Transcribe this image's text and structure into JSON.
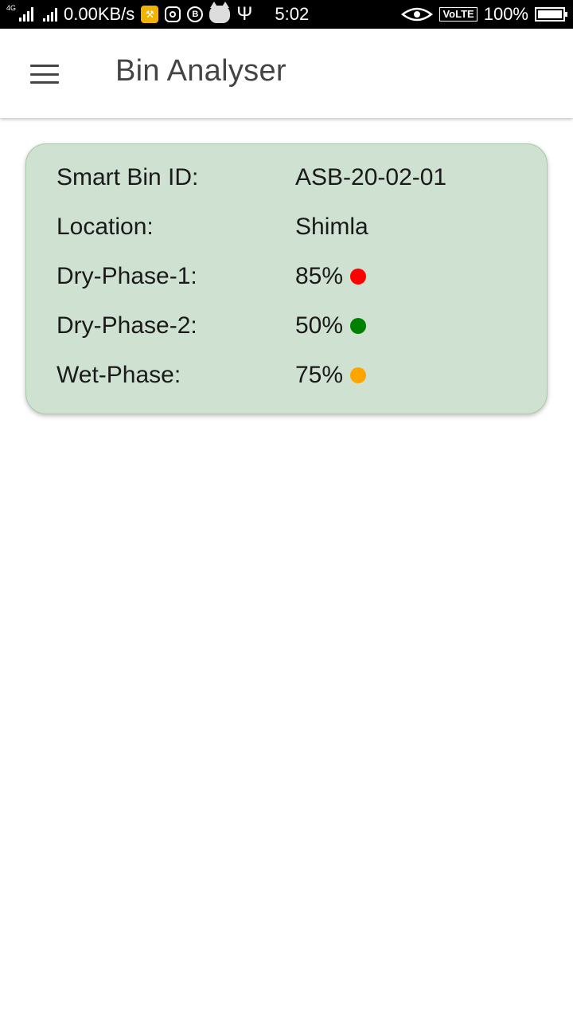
{
  "status_bar": {
    "network_type": "4G",
    "data_rate": "0.00KB/s",
    "time": "5:02",
    "volte": "VoLTE",
    "battery": "100%"
  },
  "app_bar": {
    "title": "Bin Analyser"
  },
  "bin": {
    "rows": [
      {
        "label": "Smart Bin ID:",
        "value": "ASB-20-02-01"
      },
      {
        "label": "Location:",
        "value": "Shimla"
      },
      {
        "label": "Dry-Phase-1:",
        "value": "85%",
        "status_color": "#ff0000"
      },
      {
        "label": "Dry-Phase-2:",
        "value": "50%",
        "status_color": "#008000"
      },
      {
        "label": "Wet-Phase:",
        "value": "75%",
        "status_color": "#ffa500"
      }
    ]
  },
  "colors": {
    "card_background": "#cfe1d0",
    "status_bar": "#000000",
    "app_bar": "#ffffff"
  }
}
